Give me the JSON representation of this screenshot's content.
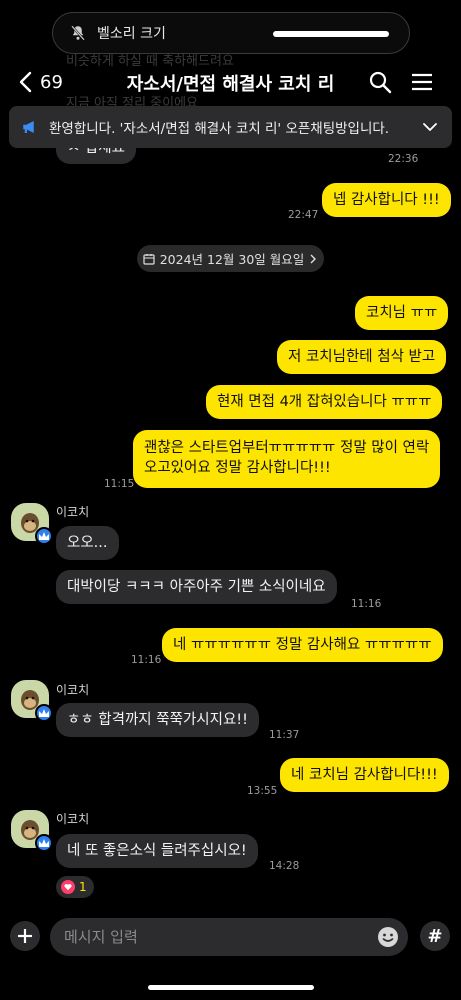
{
  "status": {
    "volume_label": "벨소리 크기"
  },
  "header": {
    "back_count": "69",
    "title": "자소서/면접 해결사 코치 리"
  },
  "notice": {
    "text": "환영합니다. '자소서/면접 해결사 코치 리' 오픈채팅방입니다."
  },
  "ghost": {
    "line1": "비슷하게 하실 때 축하해드려요",
    "line2": "지금 아직 정리 중이에요"
  },
  "messages": [
    {
      "text": "넵 감사합니다 !!!",
      "time": "22:47"
    },
    {
      "text": "코치님 ㅠㅠ",
      "time": ""
    },
    {
      "text": "저 코치님한테 첨삭 받고",
      "time": ""
    },
    {
      "text": "현재 면접 4개 잡혀있습니다 ㅠㅠㅠ",
      "time": ""
    },
    {
      "text_line1": "괜찮은 스타트업부터ㅠㅠㅠㅠㅠ 정말 많이 연락",
      "text_line2": "오고있어요 정말 감사합니다!!!",
      "time": "11:15"
    },
    {
      "text": "오오...",
      "time": ""
    },
    {
      "text": "대박이당 ㅋㅋㅋ 아주아주 기쁜 소식이네요",
      "time": "11:16"
    },
    {
      "text": "네 ㅠㅠㅠㅠㅠㅠ 정말 감사해요 ㅠㅠㅠㅠㅠ",
      "time": "11:16"
    },
    {
      "text": "ㅎㅎ 합격까지 쭉쭉가시지요!!",
      "time": "11:37"
    },
    {
      "text": "네 코치님 감사합니다!!!",
      "time": "13:55"
    },
    {
      "text": "네 또 좋은소식 들려주십시오!",
      "time": "14:28"
    }
  ],
  "top_partial": {
    "text": "ㅅ 합세요",
    "time": "22:36"
  },
  "date_divider": "2024년 12월 30일 월요일",
  "sender_name": "이코치",
  "reaction": {
    "count": "1"
  },
  "composer": {
    "placeholder": "메시지 입력",
    "hash": "#"
  },
  "colors": {
    "my_bubble": "#fee500",
    "other_bubble": "#2c2c2e",
    "background": "#000000"
  }
}
